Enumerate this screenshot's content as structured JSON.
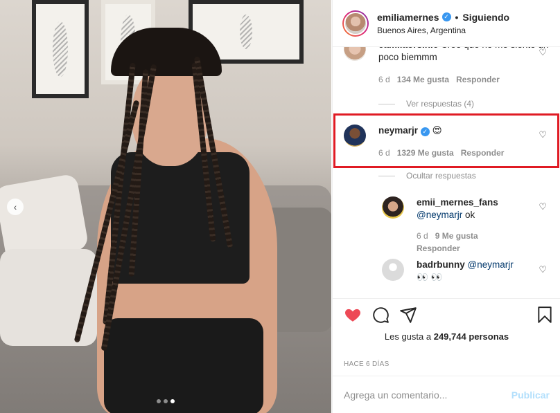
{
  "header": {
    "username": "emiliamernes",
    "separator": "•",
    "follow_status": "Siguiendo",
    "location": "Buenos Aires, Argentina"
  },
  "comments": [
    {
      "username": "camilaorsinic",
      "text": "Creo que no me siento un poco biemmm",
      "time": "6 d",
      "likes": "134 Me gusta",
      "reply": "Responder",
      "replies_toggle": "Ver respuestas (4)"
    },
    {
      "username": "neymarjr",
      "emoji": "😍",
      "time": "6 d",
      "likes": "1329 Me gusta",
      "reply": "Responder",
      "replies_toggle": "Ocultar respuestas"
    }
  ],
  "replies": [
    {
      "username": "emii_mernes_fans",
      "mention": "@neymarjr",
      "text": " ok",
      "time": "6 d",
      "likes": "9 Me gusta",
      "reply": "Responder"
    },
    {
      "username": "badrbunny",
      "mention": "@neymarjr",
      "text": " 👀 👀"
    }
  ],
  "actions": {
    "likes_prefix": "Les gusta a",
    "likes_count": "249,744 personas",
    "time_ago": "HACE 6 DÍAS"
  },
  "composer": {
    "placeholder": "Agrega un comentario...",
    "publish_label": "Publicar"
  },
  "icons": {
    "like": "heart-filled-icon",
    "comment": "comment-icon",
    "share": "share-icon",
    "save": "bookmark-icon",
    "verified": "verified-badge-icon",
    "carousel_prev": "chevron-left-icon"
  },
  "carousel": {
    "total": 3,
    "active_index": 2
  },
  "colors": {
    "like_red": "#ed4956",
    "verified_blue": "#3897f0",
    "highlight_red": "#e01b24",
    "publish_disabled": "#b2dffc"
  }
}
